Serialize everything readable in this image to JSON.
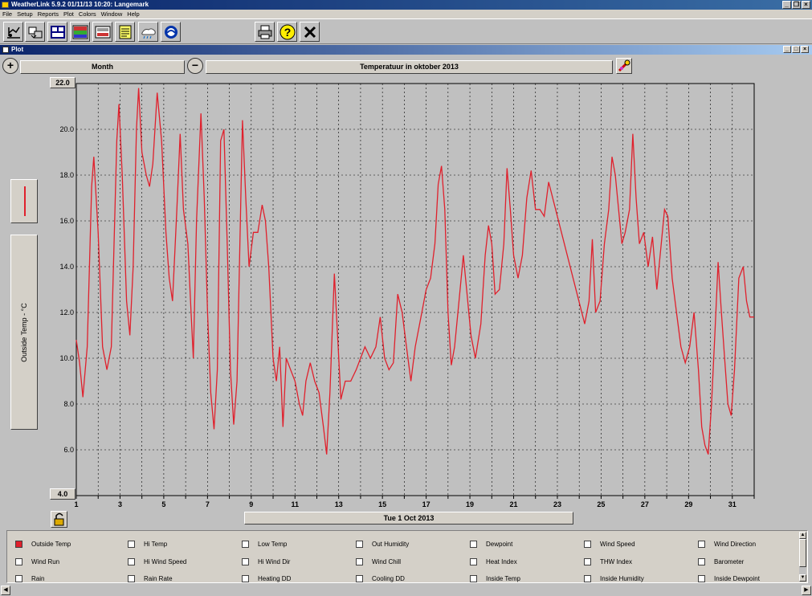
{
  "window": {
    "title": "WeatherLink 5.9.2  01/11/13  10:20: Langemark"
  },
  "menu": [
    "File",
    "Setup",
    "Reports",
    "Plot",
    "Colors",
    "Window",
    "Help"
  ],
  "toolbar": {
    "buttons": [
      "plot-weather-icon",
      "download-icon",
      "bulletin-icon",
      "strip-chart-icon",
      "summary-icon",
      "notes-icon",
      "web-icon",
      "noaa-icon",
      "print-icon",
      "help-icon",
      "close-icon"
    ]
  },
  "plot_window": {
    "title": "Plot"
  },
  "controls": {
    "span": "Month",
    "plot_title": "Temperatuur in oktober 2013",
    "date_label": "Tue 1 Oct 2013",
    "y_axis_label": "Outside Temp - °C"
  },
  "legend": [
    [
      "Outside Temp",
      "Hi Temp",
      "Low Temp",
      "Out Humidity",
      "Dewpoint",
      "Wind Speed",
      "Wind Direction"
    ],
    [
      "Wind Run",
      "Hi Wind Speed",
      "Hi Wind Dir",
      "Wind Chill",
      "Heat Index",
      "THW Index",
      "Barometer"
    ],
    [
      "Rain",
      "Rain Rate",
      "Heating DD",
      "Cooling DD",
      "Inside Temp",
      "Inside Humidity",
      "Inside Dewpoint"
    ]
  ],
  "legend_checked": [
    "Outside Temp"
  ],
  "colors": {
    "series": "#e0202c",
    "titlebar": "#0a246a"
  },
  "chart_data": {
    "type": "line",
    "title": "Temperatuur in oktober 2013",
    "ylabel": "Outside Temp - °C",
    "xlabel": "Tue 1 Oct 2013",
    "ylim": [
      4.0,
      22.0
    ],
    "xlim": [
      1,
      32
    ],
    "yticks": [
      "22.0",
      "20.0",
      "18.0",
      "16.0",
      "14.0",
      "12.0",
      "10.0",
      "8.0",
      "6.0",
      "4.0"
    ],
    "xticks": [
      "1",
      "3",
      "5",
      "7",
      "9",
      "11",
      "13",
      "15",
      "17",
      "19",
      "21",
      "23",
      "25",
      "27",
      "29",
      "31"
    ],
    "grid": true,
    "series": [
      {
        "values": [
          [
            1.0,
            10.8
          ],
          [
            1.15,
            9.8
          ],
          [
            1.3,
            8.3
          ],
          [
            1.5,
            10.5
          ],
          [
            1.7,
            17.5
          ],
          [
            1.8,
            18.8
          ],
          [
            2.0,
            15.5
          ],
          [
            2.2,
            10.5
          ],
          [
            2.4,
            9.5
          ],
          [
            2.6,
            10.5
          ],
          [
            2.85,
            19.5
          ],
          [
            2.95,
            21.1
          ],
          [
            3.1,
            18.0
          ],
          [
            3.3,
            12.5
          ],
          [
            3.45,
            11.0
          ],
          [
            3.6,
            14.0
          ],
          [
            3.75,
            20.0
          ],
          [
            3.85,
            21.8
          ],
          [
            4.0,
            19.0
          ],
          [
            4.2,
            18.0
          ],
          [
            4.35,
            17.5
          ],
          [
            4.5,
            18.5
          ],
          [
            4.7,
            21.6
          ],
          [
            4.9,
            19.5
          ],
          [
            5.1,
            15.5
          ],
          [
            5.25,
            13.5
          ],
          [
            5.4,
            12.5
          ],
          [
            5.6,
            16.5
          ],
          [
            5.75,
            19.8
          ],
          [
            5.9,
            16.5
          ],
          [
            6.1,
            15.0
          ],
          [
            6.25,
            12.0
          ],
          [
            6.35,
            10.0
          ],
          [
            6.5,
            16.0
          ],
          [
            6.7,
            20.7
          ],
          [
            6.85,
            17.0
          ],
          [
            7.0,
            12.0
          ],
          [
            7.15,
            8.5
          ],
          [
            7.3,
            6.9
          ],
          [
            7.45,
            9.5
          ],
          [
            7.6,
            19.5
          ],
          [
            7.75,
            20.0
          ],
          [
            7.9,
            15.0
          ],
          [
            8.05,
            9.5
          ],
          [
            8.2,
            7.1
          ],
          [
            8.35,
            9.0
          ],
          [
            8.6,
            20.4
          ],
          [
            8.75,
            17.0
          ],
          [
            8.9,
            14.0
          ],
          [
            9.1,
            15.5
          ],
          [
            9.3,
            15.5
          ],
          [
            9.5,
            16.7
          ],
          [
            9.65,
            16.0
          ],
          [
            9.8,
            14.0
          ],
          [
            10.0,
            10.0
          ],
          [
            10.15,
            9.0
          ],
          [
            10.3,
            10.5
          ],
          [
            10.45,
            7.0
          ],
          [
            10.6,
            10.0
          ],
          [
            10.8,
            9.5
          ],
          [
            11.0,
            9.0
          ],
          [
            11.2,
            8.0
          ],
          [
            11.35,
            7.5
          ],
          [
            11.5,
            9.0
          ],
          [
            11.7,
            9.8
          ],
          [
            11.9,
            9.0
          ],
          [
            12.1,
            8.5
          ],
          [
            12.3,
            7.0
          ],
          [
            12.45,
            5.8
          ],
          [
            12.6,
            8.5
          ],
          [
            12.8,
            13.7
          ],
          [
            12.95,
            11.0
          ],
          [
            13.1,
            8.2
          ],
          [
            13.3,
            9.0
          ],
          [
            13.55,
            9.0
          ],
          [
            13.8,
            9.5
          ],
          [
            14.0,
            10.0
          ],
          [
            14.2,
            10.5
          ],
          [
            14.45,
            10.0
          ],
          [
            14.7,
            10.5
          ],
          [
            14.9,
            11.8
          ],
          [
            15.1,
            10.0
          ],
          [
            15.3,
            9.5
          ],
          [
            15.5,
            9.8
          ],
          [
            15.7,
            12.8
          ],
          [
            15.9,
            12.0
          ],
          [
            16.1,
            10.5
          ],
          [
            16.3,
            9.0
          ],
          [
            16.5,
            10.5
          ],
          [
            16.8,
            12.0
          ],
          [
            17.0,
            13.0
          ],
          [
            17.2,
            13.5
          ],
          [
            17.4,
            15.0
          ],
          [
            17.55,
            17.6
          ],
          [
            17.7,
            18.4
          ],
          [
            17.85,
            16.5
          ],
          [
            18.0,
            12.0
          ],
          [
            18.15,
            9.7
          ],
          [
            18.3,
            10.5
          ],
          [
            18.5,
            12.5
          ],
          [
            18.7,
            14.5
          ],
          [
            18.85,
            13.0
          ],
          [
            19.05,
            11.0
          ],
          [
            19.25,
            10.0
          ],
          [
            19.5,
            11.5
          ],
          [
            19.7,
            14.5
          ],
          [
            19.85,
            15.8
          ],
          [
            20.0,
            15.0
          ],
          [
            20.15,
            12.8
          ],
          [
            20.35,
            13.0
          ],
          [
            20.55,
            15.0
          ],
          [
            20.7,
            18.3
          ],
          [
            20.85,
            16.5
          ],
          [
            21.0,
            14.5
          ],
          [
            21.2,
            13.5
          ],
          [
            21.4,
            14.5
          ],
          [
            21.6,
            17.0
          ],
          [
            21.8,
            18.2
          ],
          [
            22.0,
            16.5
          ],
          [
            22.2,
            16.5
          ],
          [
            22.4,
            16.2
          ],
          [
            22.6,
            17.7
          ],
          [
            24.25,
            11.5
          ],
          [
            24.45,
            12.5
          ],
          [
            24.6,
            15.2
          ],
          [
            24.75,
            12.0
          ],
          [
            24.95,
            12.5
          ],
          [
            25.15,
            15.0
          ],
          [
            25.35,
            16.5
          ],
          [
            25.5,
            18.8
          ],
          [
            25.65,
            18.0
          ],
          [
            25.8,
            16.5
          ],
          [
            25.95,
            15.0
          ],
          [
            26.1,
            15.5
          ],
          [
            26.3,
            16.5
          ],
          [
            26.45,
            19.8
          ],
          [
            26.6,
            17.0
          ],
          [
            26.75,
            15.0
          ],
          [
            26.95,
            15.5
          ],
          [
            27.15,
            14.0
          ],
          [
            27.35,
            15.3
          ],
          [
            27.55,
            13.0
          ],
          [
            27.75,
            15.0
          ],
          [
            27.9,
            16.5
          ],
          [
            28.05,
            16.2
          ],
          [
            28.25,
            13.5
          ],
          [
            28.45,
            12.0
          ],
          [
            28.65,
            10.5
          ],
          [
            28.85,
            9.8
          ],
          [
            29.05,
            10.5
          ],
          [
            29.25,
            12.0
          ],
          [
            29.45,
            9.5
          ],
          [
            29.6,
            7.0
          ],
          [
            29.75,
            6.2
          ],
          [
            29.9,
            5.8
          ],
          [
            30.05,
            8.0
          ],
          [
            30.2,
            11.0
          ],
          [
            30.35,
            14.2
          ],
          [
            30.5,
            12.0
          ],
          [
            30.65,
            10.0
          ],
          [
            30.8,
            8.0
          ],
          [
            30.95,
            7.5
          ],
          [
            31.1,
            9.5
          ],
          [
            31.3,
            13.5
          ],
          [
            31.5,
            14.0
          ],
          [
            31.65,
            12.5
          ],
          [
            31.8,
            11.8
          ],
          [
            32.0,
            11.8
          ]
        ]
      }
    ]
  }
}
